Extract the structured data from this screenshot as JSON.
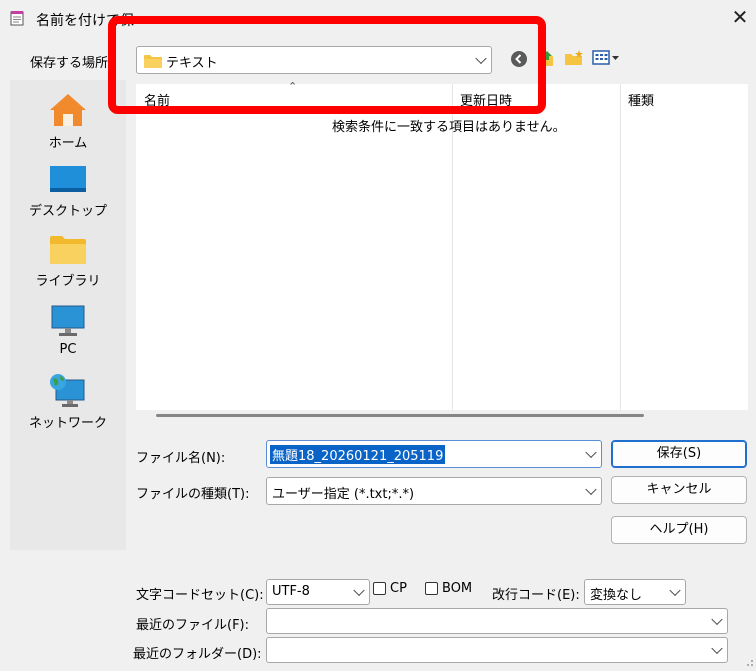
{
  "window": {
    "title": "名前を付けて保",
    "icon": "notepad-icon"
  },
  "save_in": {
    "label": "保存する場所",
    "folder": "テキスト",
    "folder_icon": "folder-icon"
  },
  "toolbar": {
    "icons": [
      "back-icon",
      "up-folder-icon",
      "new-folder-icon",
      "view-menu-icon"
    ]
  },
  "places": [
    {
      "label": "ホーム",
      "icon": "home-icon"
    },
    {
      "label": "デスクトップ",
      "icon": "desktop-icon"
    },
    {
      "label": "ライブラリ",
      "icon": "library-folder-icon"
    },
    {
      "label": "PC",
      "icon": "pc-monitor-icon"
    },
    {
      "label": "ネットワーク",
      "icon": "network-icon"
    }
  ],
  "file_list": {
    "columns": [
      "名前",
      "更新日時",
      "種類"
    ],
    "empty_message": "検索条件に一致する項目はありません。"
  },
  "form": {
    "filename_label": "ファイル名(N):",
    "filename_value": "無題18_20260121_205119",
    "filetype_label": "ファイルの種類(T):",
    "filetype_value": "ユーザー指定 (*.txt;*.*)",
    "charset_label": "文字コードセット(C):",
    "charset_value": "UTF-8",
    "cp_label": "CP",
    "bom_label": "BOM",
    "newline_label": "改行コード(E):",
    "newline_value": "変換なし",
    "recent_files_label": "最近のファイル(F):",
    "recent_folders_label": "最近のフォルダー(D):"
  },
  "buttons": {
    "save": "保存(S)",
    "cancel": "キャンセル",
    "help": "ヘルプ(H)"
  },
  "colors": {
    "highlight": "#ff0000",
    "selection": "#0a64c8",
    "folder": "#f5c443"
  }
}
